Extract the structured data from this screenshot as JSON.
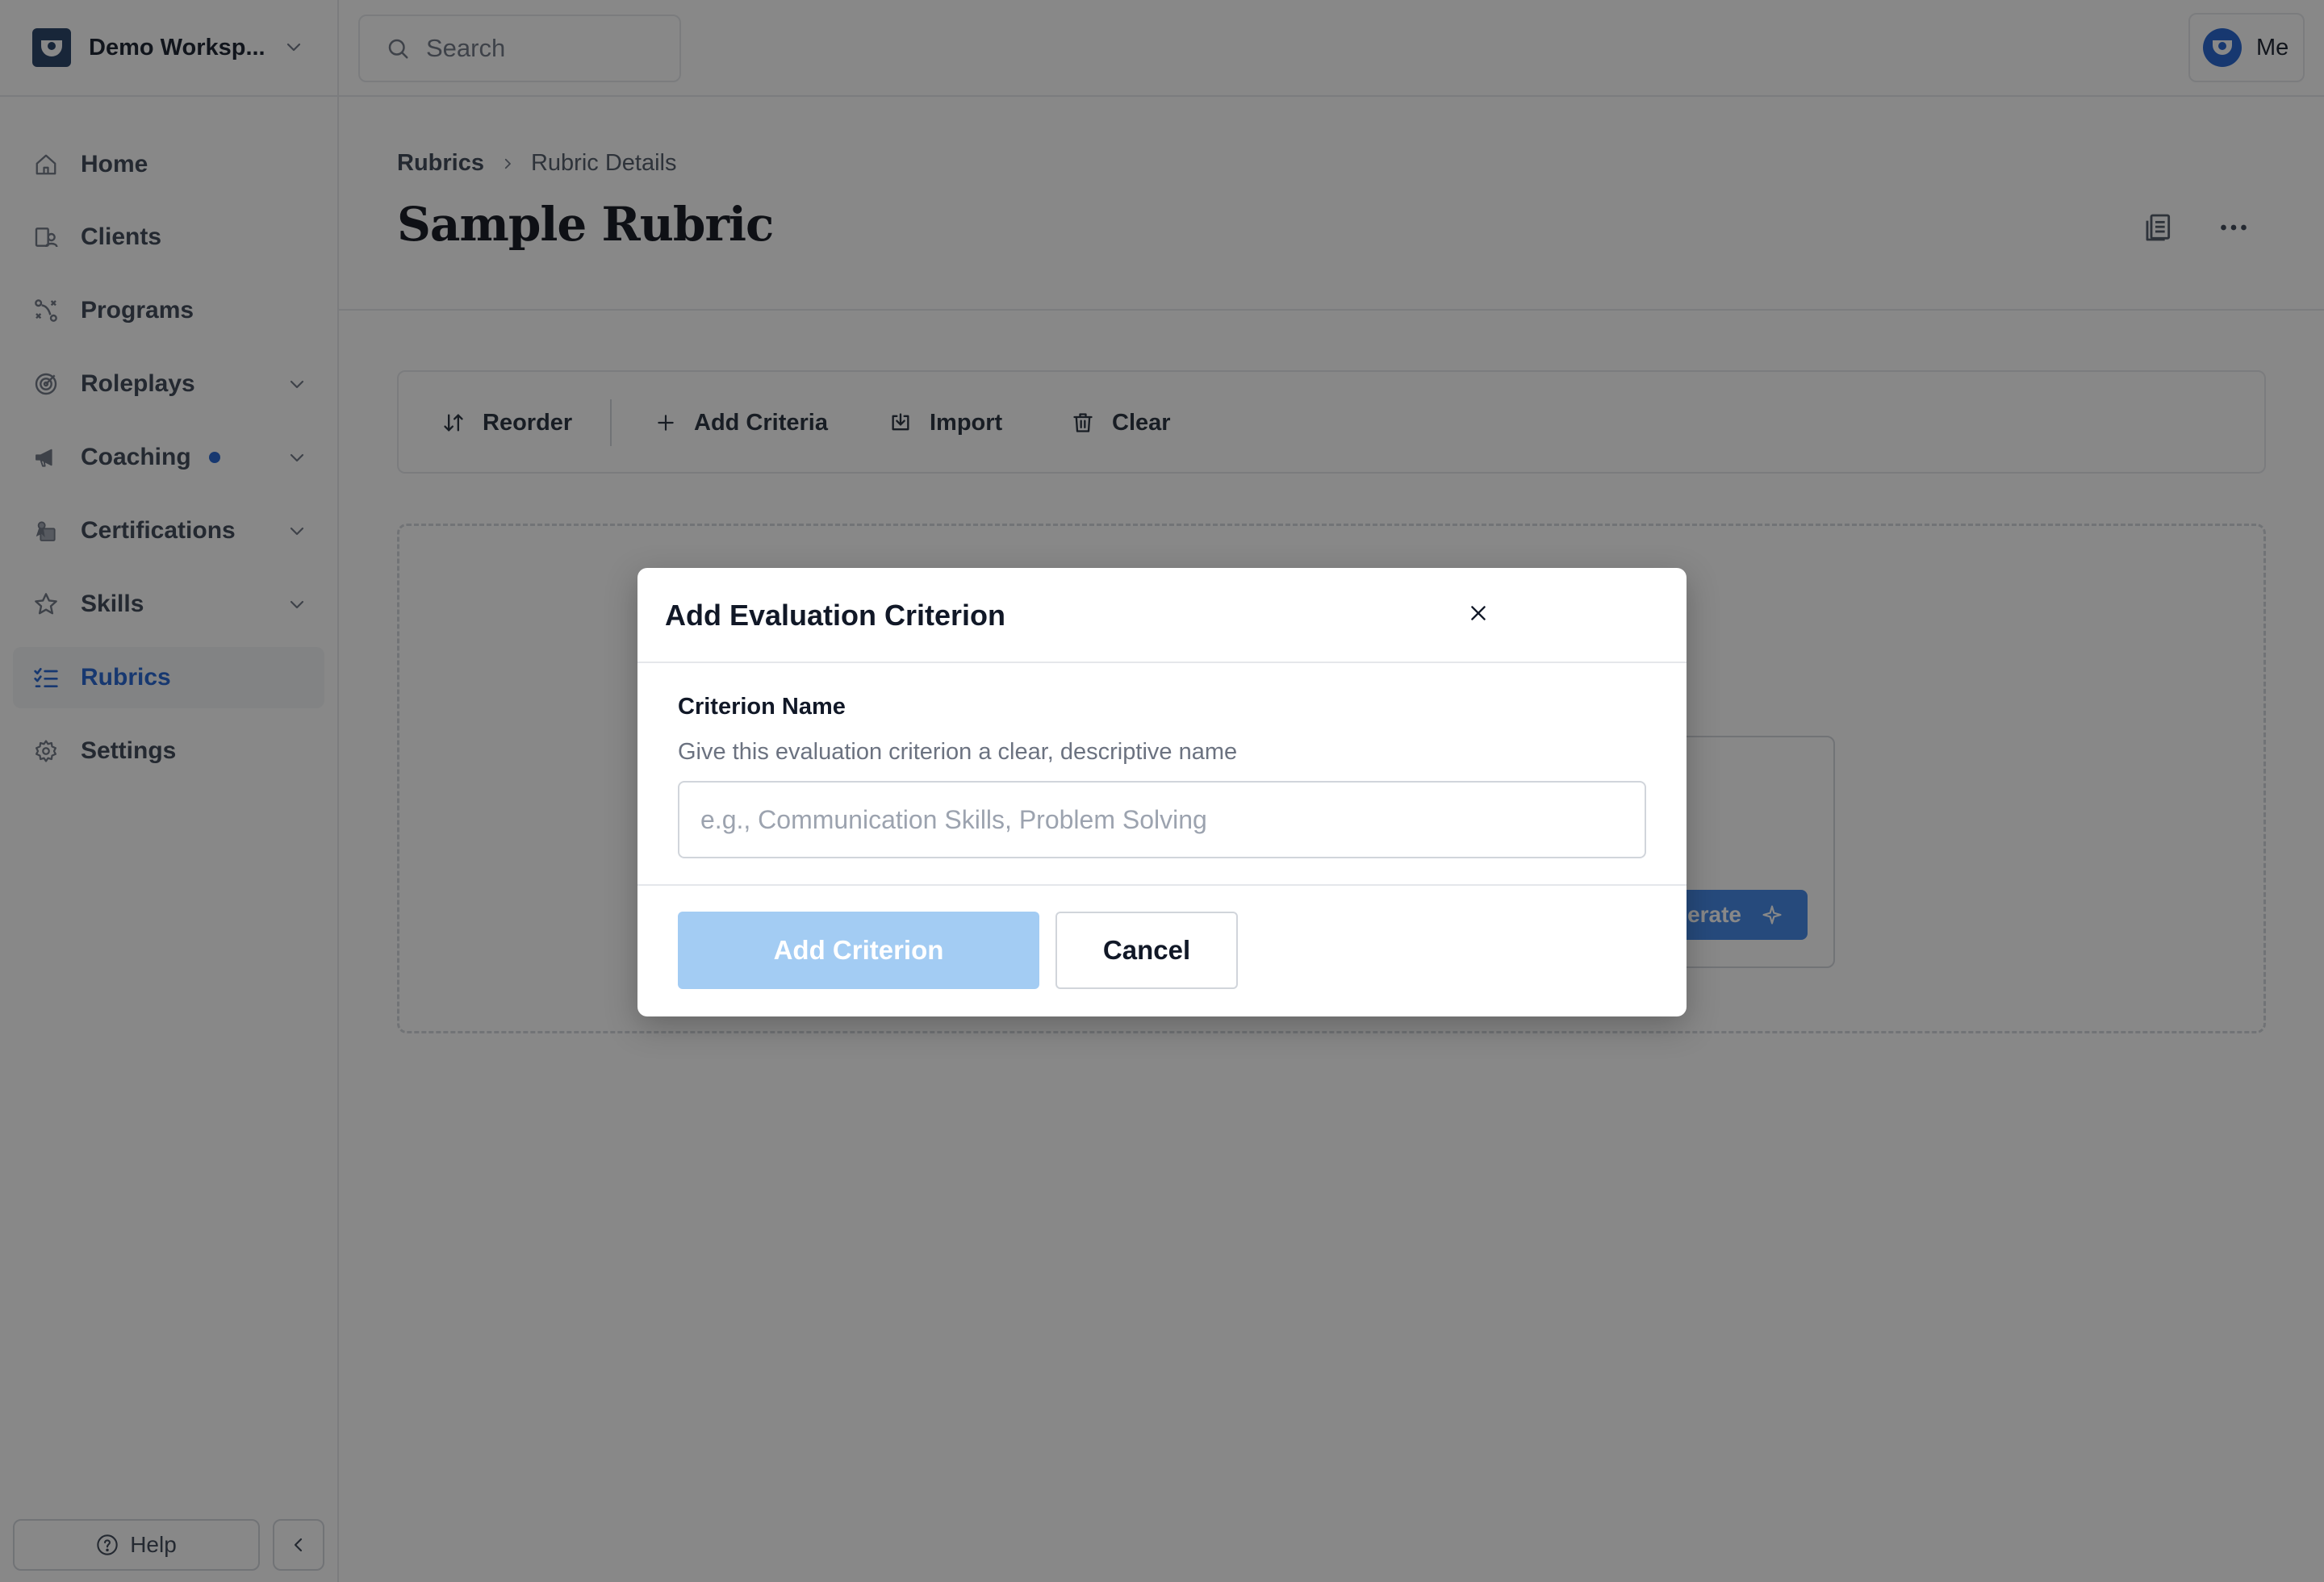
{
  "workspace": {
    "name": "Demo Worksp..."
  },
  "search": {
    "placeholder": "Search"
  },
  "user": {
    "label": "Me"
  },
  "sidebar": {
    "items": [
      {
        "label": "Home",
        "icon": "home-icon",
        "has_chevron": false
      },
      {
        "label": "Clients",
        "icon": "clients-icon",
        "has_chevron": false
      },
      {
        "label": "Programs",
        "icon": "programs-icon",
        "has_chevron": false
      },
      {
        "label": "Roleplays",
        "icon": "target-icon",
        "has_chevron": true
      },
      {
        "label": "Coaching",
        "icon": "megaphone-icon",
        "has_chevron": true,
        "badge_dot": true
      },
      {
        "label": "Certifications",
        "icon": "certificate-icon",
        "has_chevron": true
      },
      {
        "label": "Skills",
        "icon": "star-icon",
        "has_chevron": true
      },
      {
        "label": "Rubrics",
        "icon": "checklist-icon",
        "has_chevron": false,
        "active": true
      },
      {
        "label": "Settings",
        "icon": "gear-icon",
        "has_chevron": false
      }
    ],
    "help_label": "Help"
  },
  "breadcrumb": {
    "parent": "Rubrics",
    "current": "Rubric Details"
  },
  "page": {
    "title": "Sample Rubric"
  },
  "toolbar": {
    "reorder_label": "Reorder",
    "add_criteria_label": "Add Criteria",
    "import_label": "Import",
    "clear_label": "Clear"
  },
  "background_card": {
    "generate_label_partial": "erate"
  },
  "modal": {
    "title": "Add Evaluation Criterion",
    "field_label": "Criterion Name",
    "field_help": "Give this evaluation criterion a clear, descriptive name",
    "field_placeholder": "e.g., Communication Skills, Problem Solving",
    "field_value": "",
    "primary_label": "Add Criterion",
    "secondary_label": "Cancel"
  },
  "colors": {
    "accent": "#1d5fcf",
    "primary_disabled": "#a3ccf3",
    "overlay": "rgba(17,17,17,0.5)"
  }
}
